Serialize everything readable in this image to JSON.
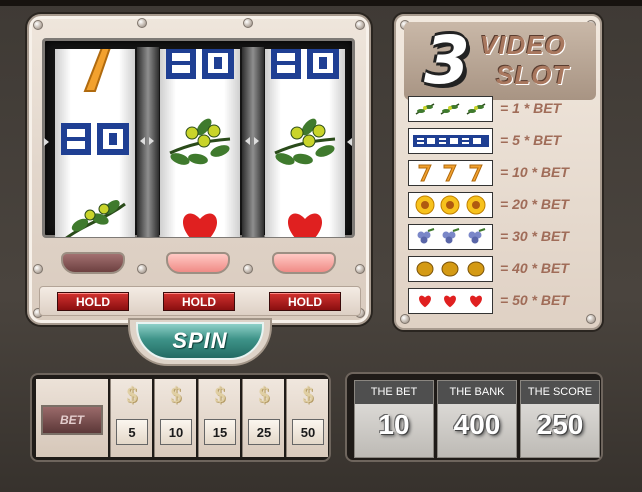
{
  "title": {
    "number": "3",
    "line1": "VIDEO",
    "line2": "SLOT"
  },
  "colors": {
    "accent_hold": "#c4282a",
    "spin": "#2f8379",
    "pay_text": "#a06c58",
    "frame": "#e6dacf"
  },
  "reels": [
    {
      "symbols": [
        "seven-icon",
        "dollar-stack-icon",
        "olive-branch-icon"
      ]
    },
    {
      "symbols": [
        "dollar-stack-icon",
        "olive-branch-icon",
        "heart-icon"
      ]
    },
    {
      "symbols": [
        "dollar-stack-icon",
        "olive-branch-icon",
        "heart-icon"
      ]
    }
  ],
  "lamps": [
    "dark",
    "lit",
    "lit"
  ],
  "hold_buttons": [
    "HOLD",
    "HOLD",
    "HOLD"
  ],
  "spin_label": "SPIN",
  "paytable": [
    {
      "icon": "olive-branch-icon",
      "payout": "= 1 * BET"
    },
    {
      "icon": "dollar-stack-icon",
      "payout": "= 5 * BET"
    },
    {
      "icon": "seven-icon",
      "payout": "= 10 * BET"
    },
    {
      "icon": "sunflower-icon",
      "payout": "= 20 * BET"
    },
    {
      "icon": "grapes-icon",
      "payout": "= 30 * BET"
    },
    {
      "icon": "lemon-icon",
      "payout": "= 40 * BET"
    },
    {
      "icon": "heart-icon",
      "payout": "= 50 * BET"
    }
  ],
  "bet": {
    "label": "BET",
    "chips": [
      {
        "symbol": "$",
        "value": "5"
      },
      {
        "symbol": "$",
        "value": "10"
      },
      {
        "symbol": "$",
        "value": "15"
      },
      {
        "symbol": "$",
        "value": "25"
      },
      {
        "symbol": "$",
        "value": "50"
      }
    ]
  },
  "scores": [
    {
      "label": "THE BET",
      "value": "10"
    },
    {
      "label": "THE BANK",
      "value": "400"
    },
    {
      "label": "THE SCORE",
      "value": "250"
    }
  ]
}
